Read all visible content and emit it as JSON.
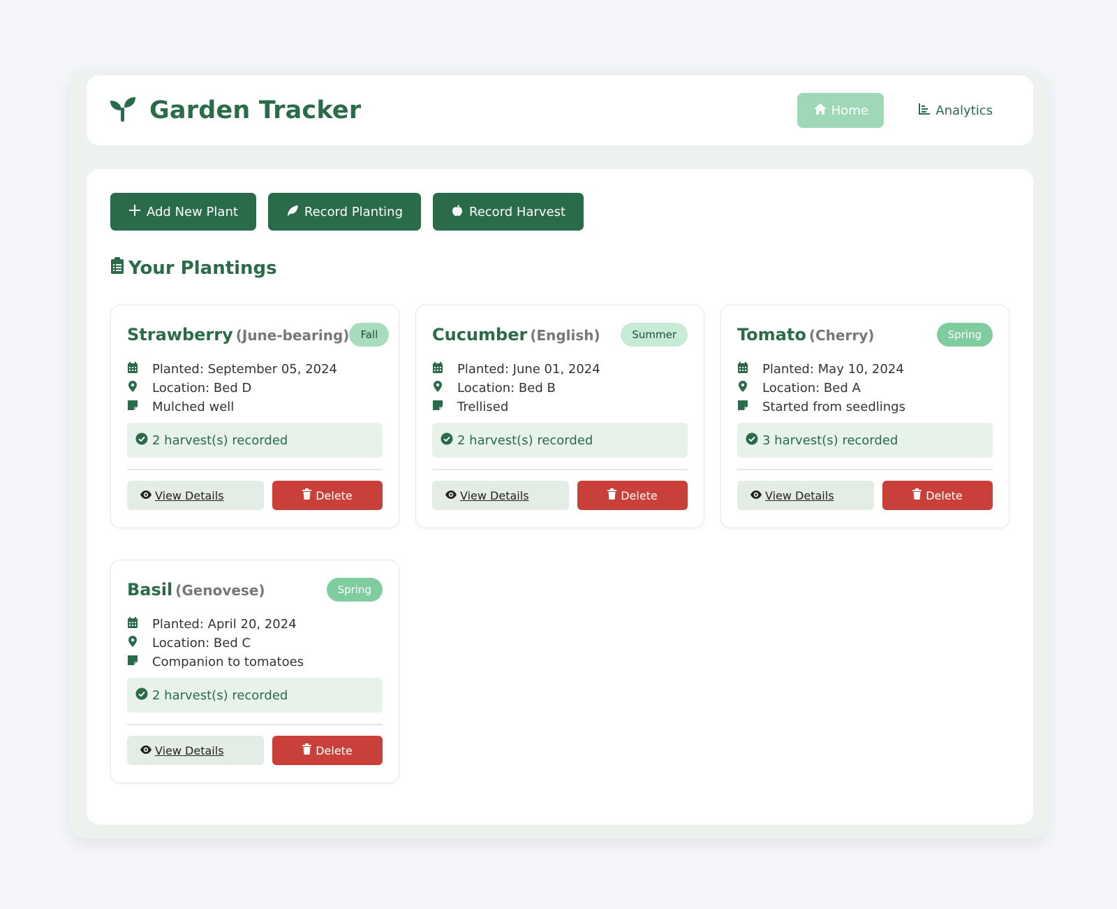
{
  "header": {
    "title": "Garden Tracker",
    "nav": [
      {
        "label": "Home",
        "icon": "home-icon",
        "active": true
      },
      {
        "label": "Analytics",
        "icon": "chart-icon",
        "active": false
      }
    ]
  },
  "actions": [
    {
      "label": "Add New Plant",
      "icon": "plus-icon"
    },
    {
      "label": "Record Planting",
      "icon": "leaf-icon"
    },
    {
      "label": "Record Harvest",
      "icon": "apple-icon"
    }
  ],
  "section_title": "Your Plantings",
  "cards": [
    {
      "name": "Strawberry",
      "variety": "(June-bearing)",
      "season": "Fall",
      "planted": "Planted: September 05, 2024",
      "location": "Location: Bed D",
      "note": "Mulched well",
      "harvest": "2 harvest(s) recorded",
      "view_label": "View Details",
      "delete_label": "Delete"
    },
    {
      "name": "Cucumber",
      "variety": "(English)",
      "season": "Summer",
      "planted": "Planted: June 01, 2024",
      "location": "Location: Bed B",
      "note": "Trellised",
      "harvest": "2 harvest(s) recorded",
      "view_label": "View Details",
      "delete_label": "Delete"
    },
    {
      "name": "Tomato",
      "variety": "(Cherry)",
      "season": "Spring",
      "planted": "Planted: May 10, 2024",
      "location": "Location: Bed A",
      "note": "Started from seedlings",
      "harvest": "3 harvest(s) recorded",
      "view_label": "View Details",
      "delete_label": "Delete"
    },
    {
      "name": "Basil",
      "variety": "(Genovese)",
      "season": "Spring",
      "planted": "Planted: April 20, 2024",
      "location": "Location: Bed C",
      "note": "Companion to tomatoes",
      "harvest": "2 harvest(s) recorded",
      "view_label": "View Details",
      "delete_label": "Delete"
    }
  ],
  "colors": {
    "primary": "#2a6b4a",
    "active_nav": "#9fd8b7",
    "delete": "#c9403a",
    "harvest_bg": "#e6f2ea"
  }
}
